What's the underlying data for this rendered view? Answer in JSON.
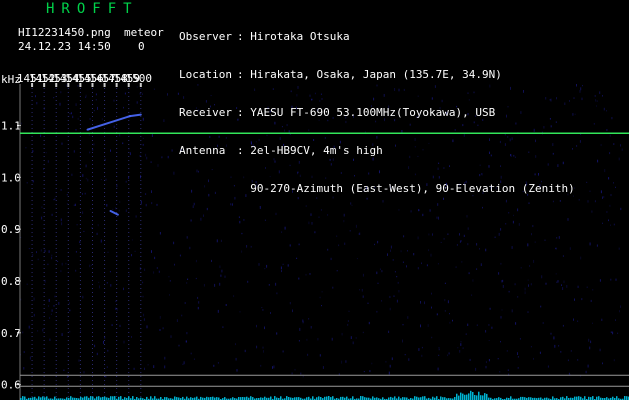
{
  "header": {
    "title": "HROFFT",
    "filename": "HI12231450.png",
    "datetime": "24.12.23 14:50",
    "meteor_label": "meteor",
    "meteor_count": "0"
  },
  "station_info": [
    {
      "key": "Observer",
      "value": "Hirotaka Otsuka"
    },
    {
      "key": "Location",
      "value": "Hirakata, Osaka, Japan (135.7E, 34.9N)"
    },
    {
      "key": "Receiver",
      "value": "YAESU FT-690 53.100MHz(Toyokawa), USB"
    },
    {
      "key": "Antenna",
      "value": "2el-HB9CV, 4m's high"
    },
    {
      "key": "",
      "value": "90-270-Azimuth (East-West), 90-Elevation (Zenith)"
    }
  ],
  "colors": {
    "background": "#000000",
    "title": "#00d24a",
    "grid": "#2a2a70",
    "carrier": "#32e65a",
    "echo": "#4c6cff",
    "noise": "#1a1a8c",
    "baseline": "#9a9a9a",
    "activity": "#00b4d2"
  },
  "chart_data": {
    "type": "heatmap",
    "xlabel": "",
    "ylabel": "kHz",
    "x_ticks": [
      "1451",
      "1452",
      "1453",
      "1454",
      "1455",
      "1456",
      "1457",
      "1458",
      "1459",
      "1500"
    ],
    "x_range": [
      1450,
      1500
    ],
    "y_ticks": [
      1.1,
      1.0,
      0.9,
      0.8,
      0.7,
      0.6
    ],
    "y_tick_labels": [
      "1.1",
      "1.0",
      "0.9",
      "0.8",
      "0.7",
      "0.6"
    ],
    "y_range": [
      0.58,
      1.18
    ],
    "carrier_khz": 1.085,
    "baseline_levels_khz": [
      0.618,
      0.597
    ],
    "echoes": [
      {
        "x_start": 1455.6,
        "x_end": 1459.1,
        "y_start": 1.092,
        "y_end": 1.118
      },
      {
        "x_start": 1459.1,
        "x_end": 1460.0,
        "y_start": 1.118,
        "y_end": 1.121
      },
      {
        "x_start": 1457.5,
        "x_end": 1458.1,
        "y_start": 0.935,
        "y_end": 0.928
      }
    ]
  }
}
